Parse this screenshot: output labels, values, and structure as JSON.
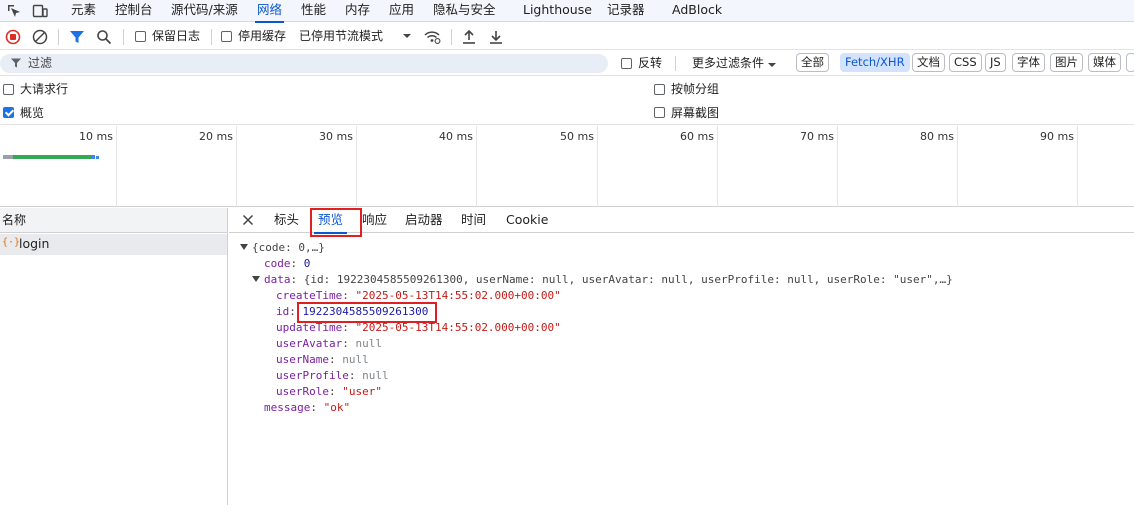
{
  "top_tabs": [
    "元素",
    "控制台",
    "源代码/来源",
    "网络",
    "性能",
    "内存",
    "应用",
    "隐私与安全",
    "Lighthouse",
    "记录器",
    "AdBlock"
  ],
  "toolbar": {
    "preserve_log": "保留日志",
    "disable_cache": "停用缓存",
    "throttle": "已停用节流模式"
  },
  "filter": {
    "placeholder": "过滤",
    "invert": "反转",
    "more_filters": "更多过滤条件",
    "types": [
      "全部",
      "Fetch/XHR",
      "文档",
      "CSS",
      "JS",
      "字体",
      "图片",
      "媒体"
    ]
  },
  "options": {
    "large_rows": "大请求行",
    "overview": "概览",
    "group_by_frame": "按帧分组",
    "screenshots": "屏幕截图"
  },
  "timeline": {
    "ticks": [
      "10 ms",
      "20 ms",
      "30 ms",
      "40 ms",
      "50 ms",
      "60 ms",
      "70 ms",
      "80 ms",
      "90 ms"
    ]
  },
  "requests": {
    "header": "名称",
    "items": [
      {
        "name": "login"
      }
    ]
  },
  "details": {
    "tabs": [
      "标头",
      "预览",
      "响应",
      "启动器",
      "时间",
      "Cookie"
    ],
    "active": "预览",
    "preview": {
      "root_summary": "{code: 0,…}",
      "code_key": "code",
      "code_val": "0",
      "data_key": "data",
      "data_summary_a": "{id: 1922304585509261300, userName: null, userAvatar: null, userProfile: null, userRole: ",
      "data_summary_role": "\"user\"",
      "data_summary_b": ",…}",
      "createTime_key": "createTime",
      "createTime_val": "\"2025-05-13T14:55:02.000+00:00\"",
      "id_key": "id",
      "id_val": "1922304585509261300",
      "updateTime_key": "updateTime",
      "updateTime_val": "\"2025-05-13T14:55:02.000+00:00\"",
      "userAvatar_key": "userAvatar",
      "userAvatar_val": "null",
      "userName_key": "userName",
      "userName_val": "null",
      "userProfile_key": "userProfile",
      "userProfile_val": "null",
      "userRole_key": "userRole",
      "userRole_val": "\"user\"",
      "message_key": "message",
      "message_val": "\"ok\""
    }
  }
}
